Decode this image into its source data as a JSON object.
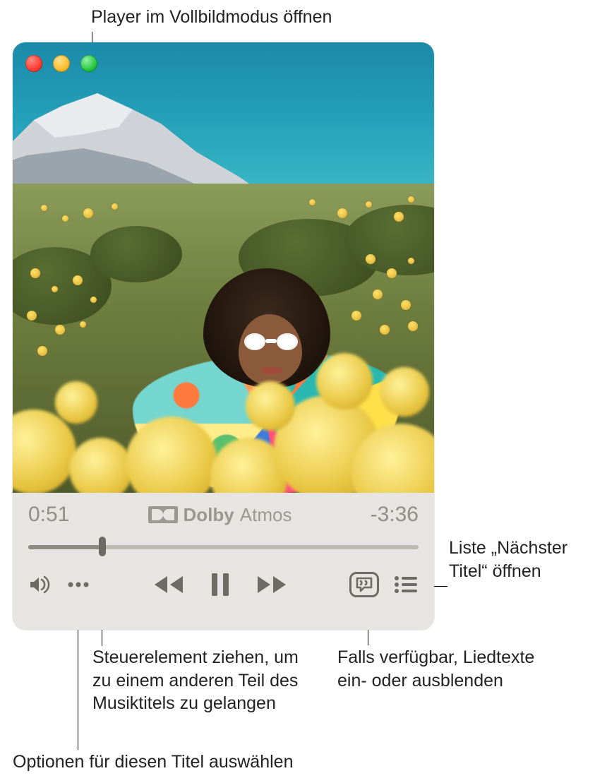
{
  "callouts": {
    "fullscreen": "Player im Vollbildmodus öffnen",
    "scrubber": "Steuerelement ziehen, um zu einem anderen Teil des Musiktitels zu gelangen",
    "options": "Optionen für diesen Titel auswählen",
    "lyrics": "Falls verfügbar, Liedtexte ein- oder ausblenden",
    "queue": "Liste „Nächster Titel“ öffnen"
  },
  "player": {
    "elapsed": "0:51",
    "remaining": "-3:36",
    "audio_badge_brand": "Dolby",
    "audio_badge_format": "Atmos",
    "progress_percent": 19
  },
  "icons": {
    "close": "close-icon",
    "minimize": "minimize-icon",
    "fullscreen": "fullscreen-icon",
    "volume": "volume-icon",
    "more": "more-icon",
    "rewind": "rewind-icon",
    "pause": "pause-icon",
    "forward": "forward-icon",
    "lyrics": "lyrics-icon",
    "queue": "queue-icon",
    "dolby": "dolby-icon"
  }
}
